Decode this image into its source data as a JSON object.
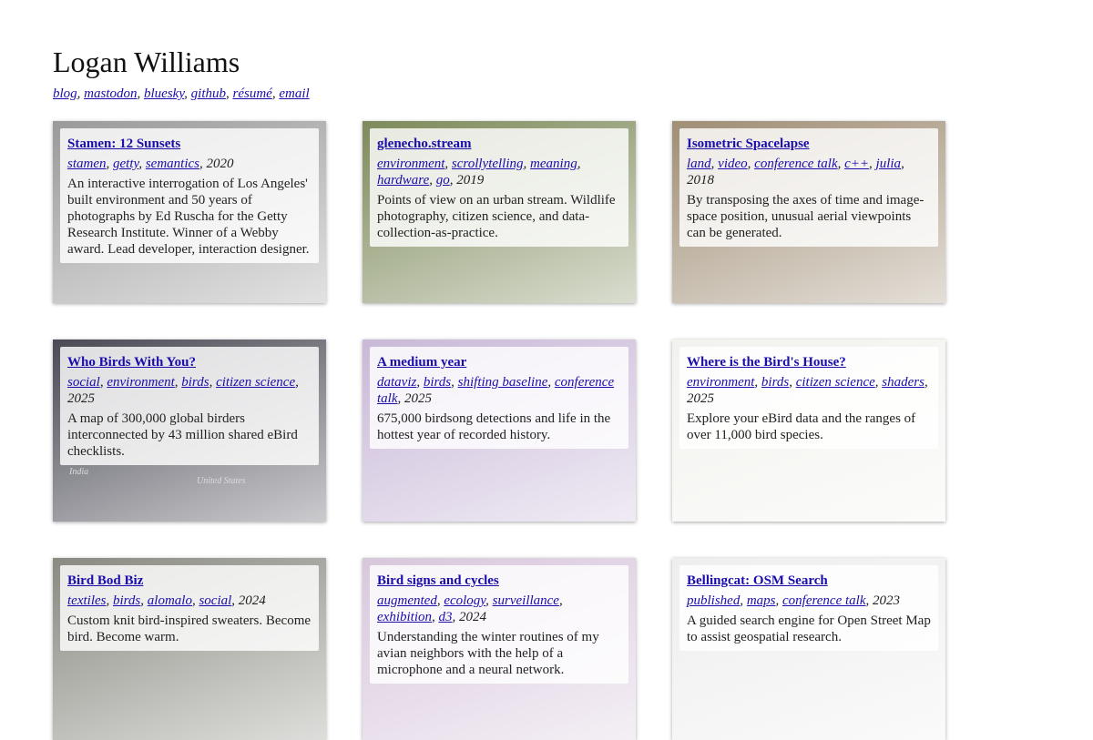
{
  "header": {
    "name": "Logan Williams",
    "links": [
      "blog",
      "mastodon",
      "bluesky",
      "github",
      "résumé",
      "email"
    ]
  },
  "cards": [
    {
      "title": "Stamen: 12 Sunsets",
      "tags": [
        "stamen",
        "getty",
        "semantics"
      ],
      "year": "2020",
      "desc": "An interactive interrogation of Los Angeles' built environment and 50 years of photographs by Ed Ruscha for the Getty Research Institute. Winner of a Webby award. Lead developer, interaction designer.",
      "theme": "#9a9a9a"
    },
    {
      "title": "glenecho.stream",
      "tags": [
        "environment",
        "scrollytelling",
        "meaning",
        "hardware",
        "go"
      ],
      "year": "2019",
      "desc": "Points of view on an urban stream. Wildlife photography, citizen science, and data-collection-as-practice.",
      "theme": "#7d8a5a"
    },
    {
      "title": "Isometric Spacelapse",
      "tags": [
        "land",
        "video",
        "conference talk",
        "c++",
        "julia"
      ],
      "year": "2018",
      "desc": "By transposing the axes of time and image-space position, unusual aerial viewpoints can be generated.",
      "theme": "#a08e75"
    },
    {
      "title": "Who Birds With You?",
      "tags": [
        "social",
        "environment",
        "birds",
        "citizen science"
      ],
      "year": "2025",
      "desc": "A map of 300,000 global birders interconnected by 43 million shared eBird checklists.",
      "theme": "#4a4a55",
      "map_labels": [
        "India",
        "United States"
      ]
    },
    {
      "title": "A medium year",
      "tags": [
        "dataviz",
        "birds",
        "shifting baseline",
        "conference talk"
      ],
      "year": "2025",
      "desc": "675,000 birdsong detections and life in the hottest year of recorded history.",
      "theme": "#c9b9d8"
    },
    {
      "title": "Where is the Bird's House?",
      "tags": [
        "environment",
        "birds",
        "citizen science",
        "shaders"
      ],
      "year": "2025",
      "desc": "Explore your eBird data and the ranges of over 11,000 bird species.",
      "theme": "#f2f2ee"
    },
    {
      "title": "Bird Bod Biz",
      "tags": [
        "textiles",
        "birds",
        "alomalo",
        "social"
      ],
      "year": "2024",
      "desc": "Custom knit bird-inspired sweaters. Become bird. Become warm.",
      "theme": "#8a8a82"
    },
    {
      "title": "Bird signs and cycles",
      "tags": [
        "augmented",
        "ecology",
        "surveillance",
        "exhibition",
        "d3"
      ],
      "year": "2024",
      "desc": "Understanding the winter routines of my avian neighbors with the help of a microphone and a neural network.",
      "theme": "#d8c7dc"
    },
    {
      "title": "Bellingcat: OSM Search",
      "tags": [
        "published",
        "maps",
        "conference talk"
      ],
      "year": "2023",
      "desc": "A guided search engine for Open Street Map to assist geospatial research.",
      "theme": "#eeeeee"
    }
  ]
}
